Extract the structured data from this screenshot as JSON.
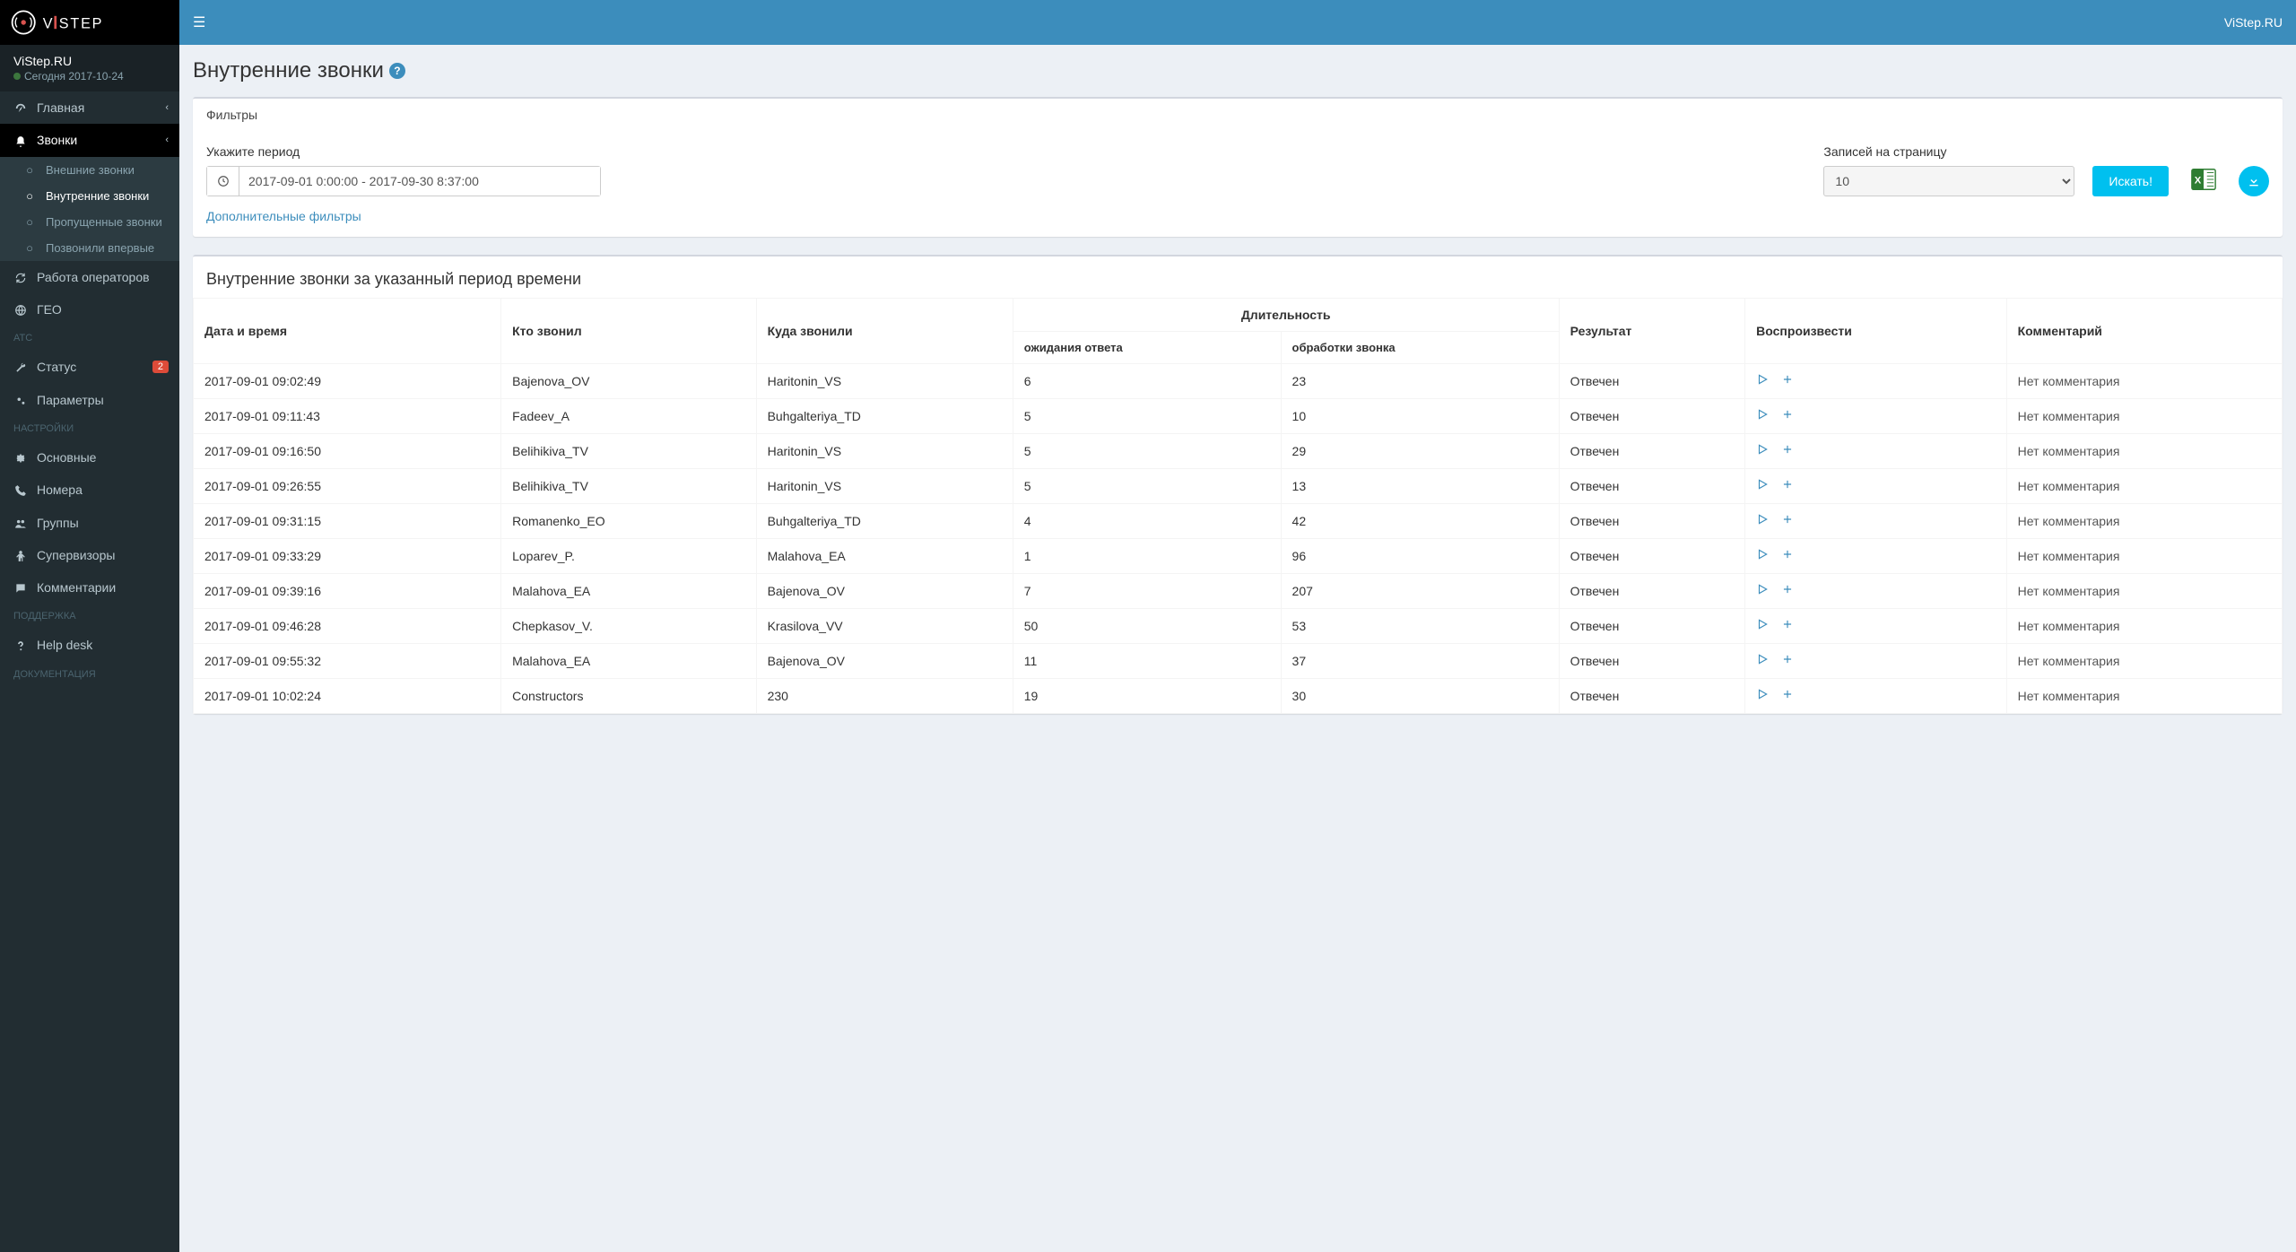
{
  "brand": "ViStep.RU",
  "logo_text": "VISTEP",
  "user": {
    "name": "ViStep.RU",
    "status": "Сегодня 2017-10-24"
  },
  "sidebar": {
    "items": [
      {
        "label": "Главная",
        "icon": "dashboard"
      },
      {
        "label": "Звонки",
        "icon": "bell",
        "children": [
          {
            "label": "Внешние звонки"
          },
          {
            "label": "Внутренние звонки",
            "active": true
          },
          {
            "label": "Пропущенные звонки"
          },
          {
            "label": "Позвонили впервые"
          }
        ]
      },
      {
        "label": "Работа операторов",
        "icon": "refresh"
      },
      {
        "label": "ГЕО",
        "icon": "globe"
      }
    ],
    "sections": {
      "atc": {
        "header": "АТС",
        "items": [
          {
            "label": "Статус",
            "icon": "wrench",
            "badge": "2"
          },
          {
            "label": "Параметры",
            "icon": "cogs"
          }
        ]
      },
      "settings": {
        "header": "НАСТРОЙКИ",
        "items": [
          {
            "label": "Основные",
            "icon": "cog"
          },
          {
            "label": "Номера",
            "icon": "phone"
          },
          {
            "label": "Группы",
            "icon": "users"
          },
          {
            "label": "Супервизоры",
            "icon": "male"
          },
          {
            "label": "Комментарии",
            "icon": "comment"
          }
        ]
      },
      "support": {
        "header": "ПОДДЕРЖКА",
        "items": [
          {
            "label": "Help desk",
            "icon": "question"
          }
        ]
      },
      "docs": {
        "header": "ДОКУМЕНТАЦИЯ"
      }
    }
  },
  "page": {
    "title": "Внутренние звонки",
    "filters_header": "Фильтры",
    "period_label": "Укажите период",
    "period_value": "2017-09-01 0:00:00 - 2017-09-30 8:37:00",
    "per_page_label": "Записей на страницу",
    "per_page_value": "10",
    "search_btn": "Искать!",
    "extra_filters": "Дополнительные фильтры",
    "table_title": "Внутренние звонки за указанный период времени"
  },
  "columns": {
    "datetime": "Дата и время",
    "caller": "Кто звонил",
    "callee": "Куда звонили",
    "duration": "Длительность",
    "wait": "ожидания ответа",
    "handle": "обработки звонка",
    "result": "Результат",
    "play": "Воспроизвести",
    "comment": "Комментарий"
  },
  "no_comment": "Нет комментария",
  "rows": [
    {
      "dt": "2017-09-01 09:02:49",
      "from": "Bajenova_OV",
      "to": "Haritonin_VS",
      "wait": "6",
      "handle": "23",
      "result": "Отвечен"
    },
    {
      "dt": "2017-09-01 09:11:43",
      "from": "Fadeev_A",
      "to": "Buhgalteriya_TD",
      "wait": "5",
      "handle": "10",
      "result": "Отвечен"
    },
    {
      "dt": "2017-09-01 09:16:50",
      "from": "Belihikiva_TV",
      "to": "Haritonin_VS",
      "wait": "5",
      "handle": "29",
      "result": "Отвечен"
    },
    {
      "dt": "2017-09-01 09:26:55",
      "from": "Belihikiva_TV",
      "to": "Haritonin_VS",
      "wait": "5",
      "handle": "13",
      "result": "Отвечен"
    },
    {
      "dt": "2017-09-01 09:31:15",
      "from": "Romanenko_EO",
      "to": "Buhgalteriya_TD",
      "wait": "4",
      "handle": "42",
      "result": "Отвечен"
    },
    {
      "dt": "2017-09-01 09:33:29",
      "from": "Loparev_P.",
      "to": "Malahova_EA",
      "wait": "1",
      "handle": "96",
      "result": "Отвечен"
    },
    {
      "dt": "2017-09-01 09:39:16",
      "from": "Malahova_EA",
      "to": "Bajenova_OV",
      "wait": "7",
      "handle": "207",
      "result": "Отвечен"
    },
    {
      "dt": "2017-09-01 09:46:28",
      "from": "Chepkasov_V.",
      "to": "Krasilova_VV",
      "wait": "50",
      "handle": "53",
      "result": "Отвечен"
    },
    {
      "dt": "2017-09-01 09:55:32",
      "from": "Malahova_EA",
      "to": "Bajenova_OV",
      "wait": "11",
      "handle": "37",
      "result": "Отвечен"
    },
    {
      "dt": "2017-09-01 10:02:24",
      "from": "Constructors",
      "to": "230",
      "wait": "19",
      "handle": "30",
      "result": "Отвечен"
    }
  ]
}
